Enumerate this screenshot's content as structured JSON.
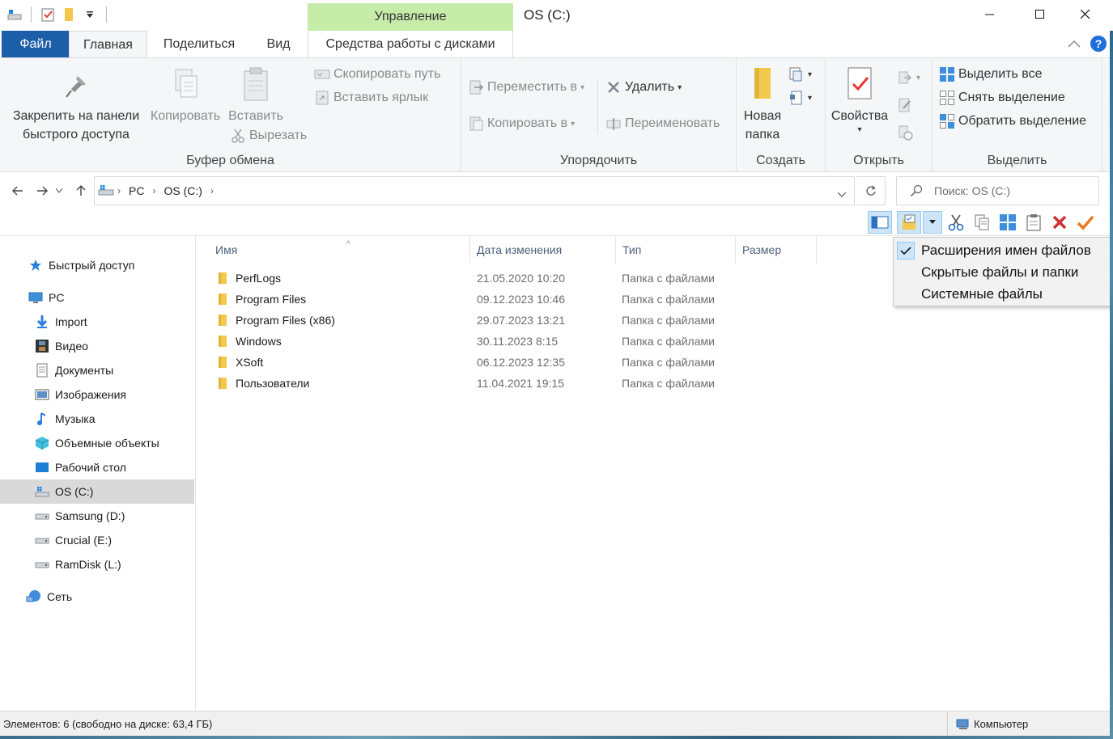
{
  "window": {
    "title": "OS (C:)",
    "context_tab_header": "Управление"
  },
  "ribbon_tabs": {
    "file": "Файл",
    "home": "Главная",
    "share": "Поделиться",
    "view": "Вид",
    "disk_tools": "Средства работы с дисками"
  },
  "ribbon": {
    "clipboard": {
      "label": "Буфер обмена",
      "pin_line1": "Закрепить на панели",
      "pin_line2": "быстрого доступа",
      "copy": "Копировать",
      "paste": "Вставить",
      "cut": "Вырезать",
      "copy_path": "Скопировать путь",
      "paste_shortcut": "Вставить ярлык"
    },
    "organize": {
      "label": "Упорядочить",
      "move_to": "Переместить в",
      "copy_to": "Копировать в",
      "delete": "Удалить",
      "rename": "Переименовать"
    },
    "new": {
      "label": "Создать",
      "new_folder_line1": "Новая",
      "new_folder_line2": "папка"
    },
    "open": {
      "label": "Открыть",
      "properties": "Свойства"
    },
    "select": {
      "label": "Выделить",
      "select_all": "Выделить все",
      "select_none": "Снять выделение",
      "invert": "Обратить выделение"
    }
  },
  "address": {
    "crumbs": [
      "PC",
      "OS (C:)"
    ],
    "search_placeholder": "Поиск: OS (C:)"
  },
  "nav": {
    "quick_access": "Быстрый доступ",
    "pc": "PC",
    "items": [
      "Import",
      "Видео",
      "Документы",
      "Изображения",
      "Музыка",
      "Объемные объекты",
      "Рабочий стол",
      "OS (C:)",
      "Samsung (D:)",
      "Crucial (E:)",
      "RamDisk (L:)"
    ],
    "network": "Сеть",
    "selected": "OS (C:)"
  },
  "columns": {
    "name": "Имя",
    "date": "Дата изменения",
    "type": "Тип",
    "size": "Размер"
  },
  "files": [
    {
      "name": "PerfLogs",
      "date": "21.05.2020 10:20",
      "type": "Папка с файлами"
    },
    {
      "name": "Program Files",
      "date": "09.12.2023 10:46",
      "type": "Папка с файлами"
    },
    {
      "name": "Program Files (x86)",
      "date": "29.07.2023 13:21",
      "type": "Папка с файлами"
    },
    {
      "name": "Windows",
      "date": "30.11.2023 8:15",
      "type": "Папка с файлами"
    },
    {
      "name": "XSoft",
      "date": "06.12.2023 12:35",
      "type": "Папка с файлами"
    },
    {
      "name": "Пользователи",
      "date": "11.04.2021 19:15",
      "type": "Папка с файлами"
    }
  ],
  "menu": {
    "items": [
      {
        "label": "Расширения имен файлов",
        "checked": true
      },
      {
        "label": "Скрытые файлы и папки",
        "checked": false
      },
      {
        "label": "Системные файлы",
        "checked": false
      }
    ]
  },
  "status": {
    "left": "Элементов: 6 (свободно на диске: 63,4 ГБ)",
    "right": "Компьютер"
  },
  "colors": {
    "file_tab": "#1c5ea8",
    "manage_tab": "#c6ecaa",
    "folder": "#f2c94c",
    "delete_red": "#d32f2f",
    "check_orange": "#e8781e"
  }
}
